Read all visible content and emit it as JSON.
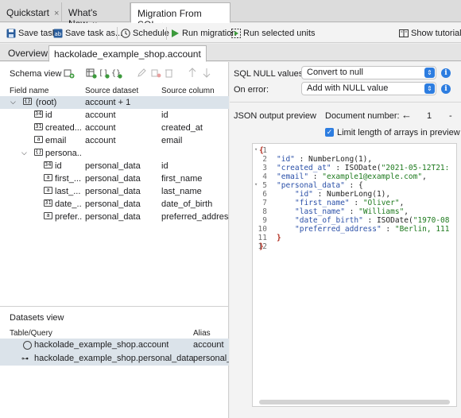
{
  "tabs": [
    {
      "label": "Quickstart",
      "close": "×"
    },
    {
      "label": "What's New",
      "close": "×"
    },
    {
      "label": "Migration From SQL",
      "close": "×"
    }
  ],
  "toolbar": {
    "save_task": "Save task",
    "save_task_as": "Save task as...",
    "schedule": "Schedule",
    "run_migration": "Run migration",
    "run_selected": "Run selected units",
    "show_tutorial": "Show tutorial"
  },
  "subtabs": [
    "Overview",
    "hackolade_example_shop.account"
  ],
  "schema": {
    "title": "Schema view",
    "columns": [
      "Field name",
      "Source dataset",
      "Source column"
    ],
    "rows": [
      {
        "name": "(root)",
        "dataset": "account + 1",
        "column": ""
      },
      {
        "name": "id",
        "dataset": "account",
        "column": "id"
      },
      {
        "name": "created...",
        "dataset": "account",
        "column": "created_at"
      },
      {
        "name": "email",
        "dataset": "account",
        "column": "email"
      },
      {
        "name": "persona...",
        "dataset": "",
        "column": ""
      },
      {
        "name": "id",
        "dataset": "personal_data",
        "column": "id"
      },
      {
        "name": "first_...",
        "dataset": "personal_data",
        "column": "first_name"
      },
      {
        "name": "last_...",
        "dataset": "personal_data",
        "column": "last_name"
      },
      {
        "name": "date_...",
        "dataset": "personal_data",
        "column": "date_of_birth"
      },
      {
        "name": "prefer...",
        "dataset": "personal_data",
        "column": "preferred_address"
      }
    ]
  },
  "datasets": {
    "title": "Datasets view",
    "columns": [
      "Table/Query",
      "Alias"
    ],
    "rows": [
      {
        "table": "hackolade_example_shop.account",
        "alias": "account"
      },
      {
        "table": "hackolade_example_shop.personal_data",
        "alias": "personal_"
      }
    ]
  },
  "options": {
    "null_label": "SQL NULL values:",
    "null_value": "Convert to null",
    "error_label": "On error:",
    "error_value": "Add with NULL value"
  },
  "preview": {
    "title": "JSON output preview",
    "doc_label": "Document number:",
    "doc_arrow": "←",
    "doc_number": "1",
    "doc_trailing": "-",
    "limit_label": "Limit length of arrays in preview",
    "limit_checked": true
  },
  "code_lines": [
    "1",
    "2",
    "3",
    "4",
    "5",
    "6",
    "7",
    "8",
    "9",
    "10",
    "11",
    "12"
  ],
  "code": {
    "l1": "{",
    "l2k": "\"id\"",
    "l2v": " : NumberLong(1),",
    "l3k": "\"created_at\"",
    "l3p": " : ISODate(",
    "l3s": "\"2021-05-12T21:",
    "l4k": "\"email\"",
    "l4p": " : ",
    "l4s": "\"example1@example.com\"",
    "l4e": ",",
    "l5k": "\"personal_data\"",
    "l5p": " : {",
    "l6k": "\"id\"",
    "l6v": " : NumberLong(1),",
    "l7k": "\"first_name\"",
    "l7p": " : ",
    "l7s": "\"Oliver\"",
    "l7e": ",",
    "l8k": "\"last_name\"",
    "l8p": " : ",
    "l8s": "\"Williams\"",
    "l8e": ",",
    "l9k": "\"date_of_birth\"",
    "l9p": " : ISODate(",
    "l9s": "\"1970-08",
    "l10k": "\"preferred_address\"",
    "l10p": " : ",
    "l10s": "\"Berlin, 111",
    "l11": "}",
    "l12": "}"
  },
  "colors": {
    "accent": "#2d7de0",
    "selected_row": "#dbe3ea"
  }
}
